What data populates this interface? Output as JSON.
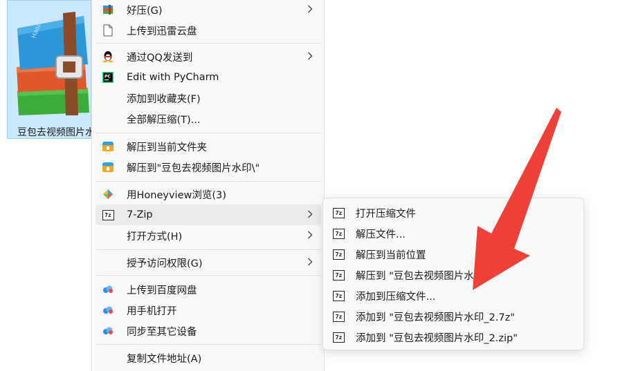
{
  "file": {
    "label": "豆包去视频图片水印"
  },
  "menu": {
    "items": [
      {
        "label": "好压(G)",
        "icon": "haozip-icon",
        "submenu": true
      },
      {
        "label": "上传到迅雷云盘",
        "icon": "document-icon"
      },
      {
        "label": "通过QQ发送到",
        "icon": "qq-penguin-icon",
        "submenu": true
      },
      {
        "label": "Edit with PyCharm",
        "icon": "pycharm-icon"
      },
      {
        "label": "添加到收藏夹(F)",
        "icon": ""
      },
      {
        "label": "全部解压缩(T)...",
        "icon": ""
      },
      {
        "label": "解压到当前文件夹",
        "icon": "bandizip-icon"
      },
      {
        "label": "解压到\"豆包去视频图片水印\\\"",
        "icon": "bandizip-icon"
      },
      {
        "label": "用Honeyview浏览(3)",
        "icon": "honeyview-icon"
      },
      {
        "label": "7-Zip",
        "icon": "7zip-icon",
        "submenu": true
      },
      {
        "label": "打开方式(H)",
        "icon": "",
        "submenu": true
      },
      {
        "label": "授予访问权限(G)",
        "icon": "",
        "submenu": true
      },
      {
        "label": "上传到百度网盘",
        "icon": "baidu-cloud-icon"
      },
      {
        "label": "用手机打开",
        "icon": "baidu-cloud-icon"
      },
      {
        "label": "同步至其它设备",
        "icon": "baidu-cloud-icon"
      },
      {
        "label": "复制文件地址(A)",
        "icon": ""
      }
    ]
  },
  "submenu_7zip": {
    "items": [
      {
        "label": "打开压缩文件"
      },
      {
        "label": "解压文件..."
      },
      {
        "label": "解压到当前位置"
      },
      {
        "label": "解压到 \"豆包去视频图片水印\\\""
      },
      {
        "label": "添加到压缩文件..."
      },
      {
        "label": "添加到 \"豆包去视频图片水印_2.7z\""
      },
      {
        "label": "添加到 \"豆包去视频图片水印_2.zip\""
      }
    ],
    "icon_text": "7z"
  },
  "colors": {
    "selection": "#cce8ff",
    "hover": "#ebebeb",
    "annotation_arrow": "#f0403a"
  }
}
